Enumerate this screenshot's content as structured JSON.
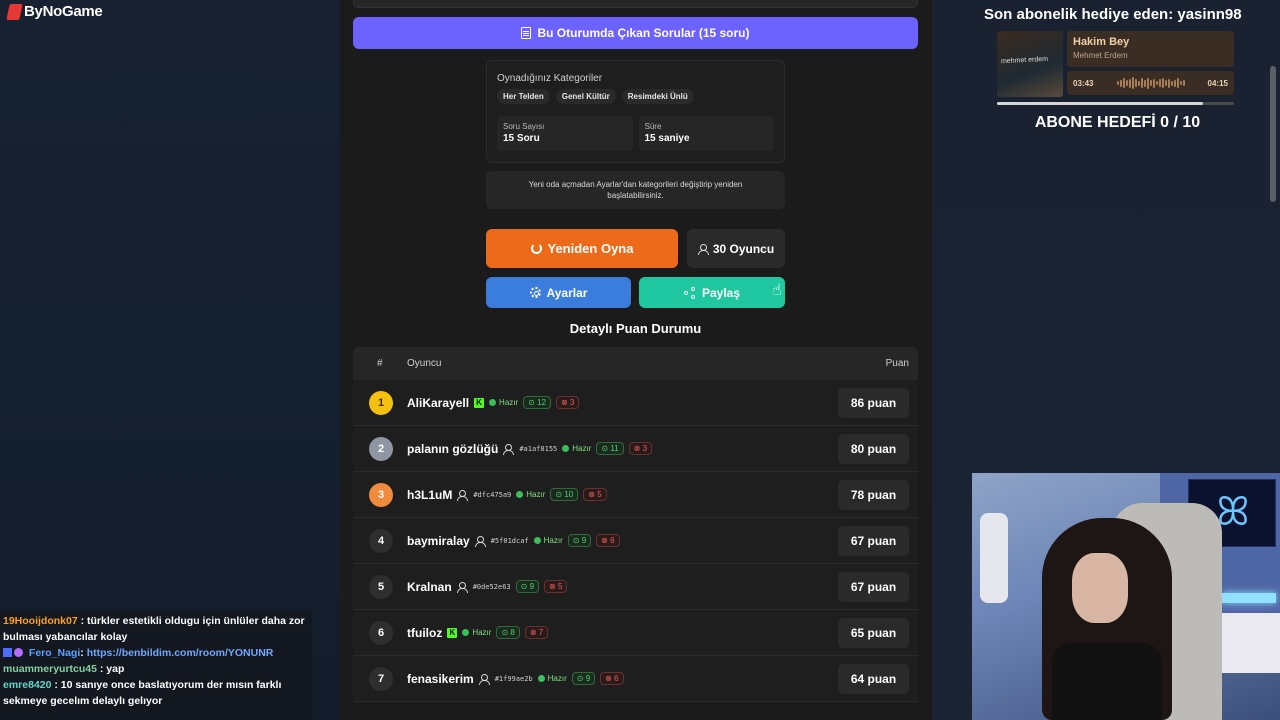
{
  "brand": "ByNoGame",
  "questions_button": "Bu Oturumda Çıkan Sorular (15 soru)",
  "categories": {
    "title": "Oynadığınız Kategoriler",
    "items": [
      "Her Telden",
      "Genel Kültür",
      "Resimdeki Ünlü"
    ],
    "stats": [
      {
        "label": "Soru Sayısı",
        "value": "15 Soru"
      },
      {
        "label": "Süre",
        "value": "15 saniye"
      }
    ]
  },
  "note": "Yeni oda açmadan Ayarlar'dan kategorileri değiştirip yeniden başlatabilirsiniz.",
  "actions": {
    "replay": "Yeniden Oyna",
    "players": "30 Oyuncu",
    "settings": "Ayarlar",
    "share": "Paylaş"
  },
  "section_title": "Detaylı Puan Durumu",
  "table": {
    "headers": {
      "num": "#",
      "player": "Oyuncu",
      "score": "Puan"
    },
    "rows": [
      {
        "rank": "1",
        "name": "AliKarayell",
        "kick": true,
        "uid": "",
        "ready": "Hazır",
        "correct": "12",
        "wrong": "3",
        "score": "86 puan"
      },
      {
        "rank": "2",
        "name": "palanın gözlüğü",
        "kick": false,
        "uid": "#a1af8155",
        "ready": "Hazır",
        "correct": "11",
        "wrong": "3",
        "score": "80 puan"
      },
      {
        "rank": "3",
        "name": "h3L1uM",
        "kick": false,
        "uid": "#dfc475a9",
        "ready": "Hazır",
        "correct": "10",
        "wrong": "5",
        "score": "78 puan"
      },
      {
        "rank": "4",
        "name": "baymiralay",
        "kick": false,
        "uid": "#5f01dcaf",
        "ready": "Hazır",
        "correct": "9",
        "wrong": "6",
        "score": "67 puan"
      },
      {
        "rank": "5",
        "name": "Kralnan",
        "kick": false,
        "uid": "#0de52e63",
        "ready": "",
        "correct": "9",
        "wrong": "5",
        "score": "67 puan"
      },
      {
        "rank": "6",
        "name": "tfuiloz",
        "kick": true,
        "uid": "",
        "ready": "Hazır",
        "correct": "8",
        "wrong": "7",
        "score": "65 puan"
      },
      {
        "rank": "7",
        "name": "fenasikerim",
        "kick": false,
        "uid": "#1f99ae2b",
        "ready": "Hazır",
        "correct": "9",
        "wrong": "6",
        "score": "64 puan"
      }
    ]
  },
  "overlay": {
    "sub_gift": "Son abonelik hediye eden: yasinn98",
    "song_title": "Hakim Bey",
    "song_artist": "Mehmet Erdem",
    "album_text": "mehmet erdem",
    "time_current": "03:43",
    "time_total": "04:15",
    "progress": 0.87,
    "sub_goal": "ABONE HEDEFİ 0 / 10"
  },
  "chat": [
    {
      "user": "19Hooijdonk07",
      "user_color": "#ff9f1a",
      "text": ": türkler estetikli oldugu için ünlüler daha zor bulması yabancılar kolay"
    },
    {
      "user": "Fero_Nagi",
      "user_color": "#5aa2ff",
      "text": ": ",
      "link": "https://benbildim.com/room/YONUNR"
    },
    {
      "user": "muammeryurtcu45",
      "user_color": "#7fd2a0",
      "text": ": yap"
    },
    {
      "user": "emre8420",
      "user_color": "#62d6c6",
      "text": ": 10 sanıye once baslatıyorum der mısın farklı sekmeye gecelım delaylı gelıyor"
    }
  ]
}
